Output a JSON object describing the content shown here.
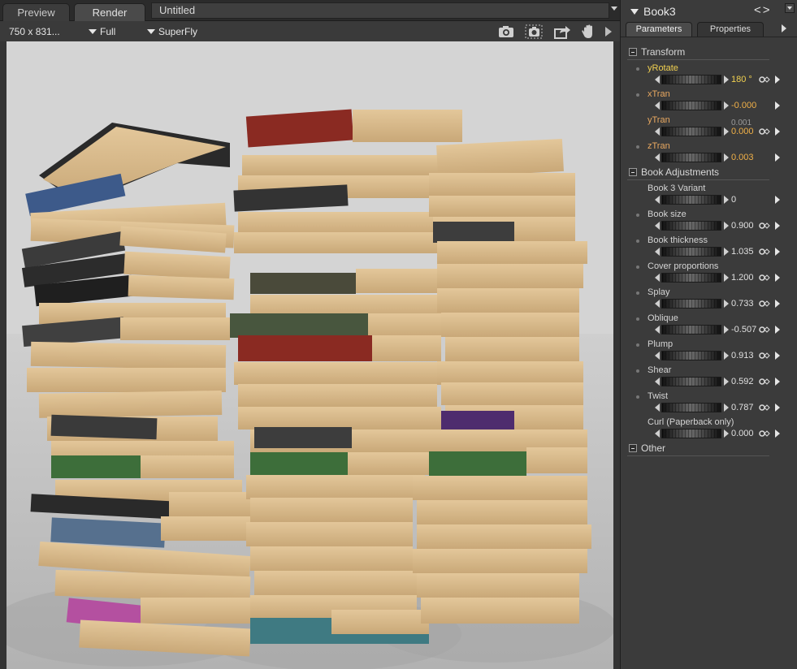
{
  "tabs": [
    "Preview",
    "Render"
  ],
  "document_title": "Untitled",
  "toolbar": {
    "resolution": "750 x 831...",
    "size_mode": "Full",
    "render_engine": "SuperFly",
    "icons": [
      "camera-icon",
      "camera-dashed-icon",
      "share-icon",
      "hand-icon",
      "menu-arrow-icon"
    ]
  },
  "panel": {
    "title": "Book3",
    "tabs": [
      "Parameters",
      "Properties"
    ],
    "sections": {
      "transform": "Transform",
      "book_adjustments": "Book Adjustments",
      "other": "Other"
    },
    "params": [
      {
        "name": "yRotate",
        "value": "180 °"
      },
      {
        "name": "xTran",
        "value": "-0.000"
      },
      {
        "name": "yTran",
        "value": "0.000",
        "secondary": "0.001"
      },
      {
        "name": "zTran",
        "value": "0.003"
      },
      {
        "name": "Book 3 Variant",
        "value": "0"
      },
      {
        "name": "Book size",
        "value": "0.900"
      },
      {
        "name": "Book thickness",
        "value": "1.035"
      },
      {
        "name": "Cover proportions",
        "value": "1.200"
      },
      {
        "name": "Splay",
        "value": "0.733"
      },
      {
        "name": "Oblique",
        "value": "-0.507"
      },
      {
        "name": "Plump",
        "value": "0.913"
      },
      {
        "name": "Shear",
        "value": "0.592"
      },
      {
        "name": "Twist",
        "value": "0.787"
      },
      {
        "name": "Curl (Paperback only)",
        "value": "0.000"
      }
    ]
  },
  "colors": {
    "highlight": "#f0d050",
    "modified": "#f0b048",
    "page": "#d8b98a",
    "spine_red": "#8a2a22",
    "spine_blue": "#3f5c8a",
    "spine_green": "#3d6e3a"
  }
}
